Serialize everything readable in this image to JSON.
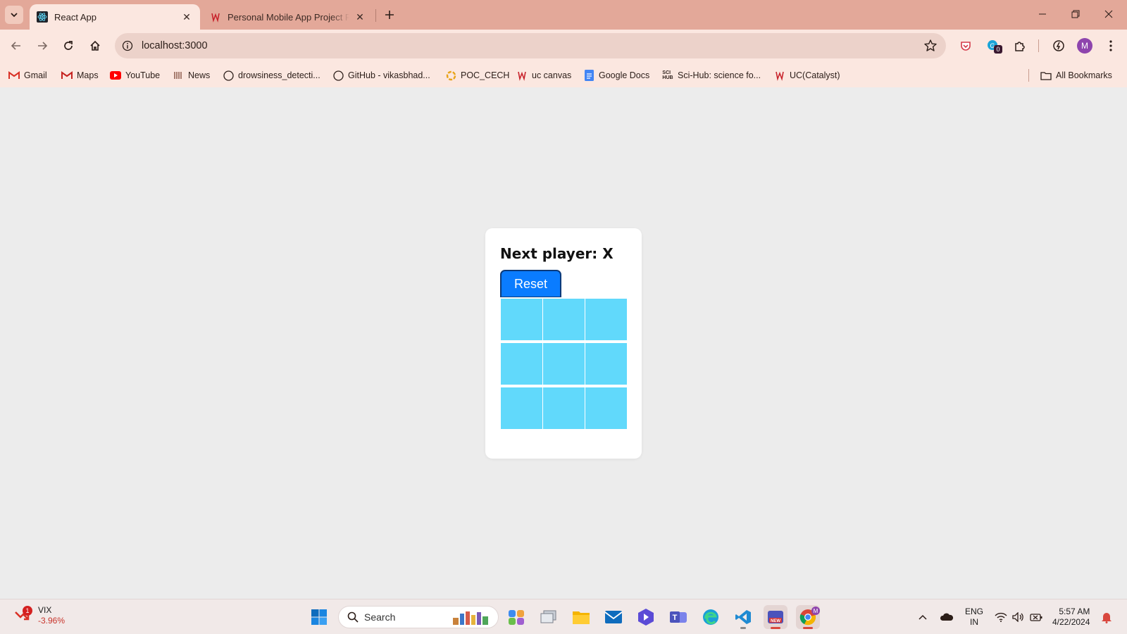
{
  "browser": {
    "tabs": [
      {
        "title": "React App",
        "active": true,
        "icon": "react-icon"
      },
      {
        "title": "Personal Mobile App Project Fi",
        "active": false,
        "icon": "uc-icon"
      }
    ],
    "address": "localhost:3000",
    "bookmarks": [
      {
        "label": "Gmail",
        "icon": "gmail-icon"
      },
      {
        "label": "Maps",
        "icon": "maps-icon"
      },
      {
        "label": "YouTube",
        "icon": "youtube-icon"
      },
      {
        "label": "News",
        "icon": "news-icon"
      },
      {
        "label": "drowsiness_detecti...",
        "icon": "github-icon"
      },
      {
        "label": "GitHub - vikasbhad...",
        "icon": "github-icon"
      },
      {
        "label": "POC_CECH",
        "icon": "poc-icon"
      },
      {
        "label": "uc canvas",
        "icon": "uc-icon"
      },
      {
        "label": "Google Docs",
        "icon": "docs-icon"
      },
      {
        "label": "Sci-Hub: science fo...",
        "icon": "scihub-icon"
      },
      {
        "label": "UC(Catalyst)",
        "icon": "uc-icon"
      }
    ],
    "all_bookmarks": "All Bookmarks",
    "extension_badge": "0",
    "profile_initial": "M"
  },
  "game": {
    "status": "Next player: X",
    "reset_label": "Reset",
    "squares": [
      "",
      "",
      "",
      "",
      "",
      "",
      "",
      "",
      ""
    ],
    "square_color": "#61d9fb",
    "button_color": "#0a7cff"
  },
  "taskbar": {
    "widget": {
      "name": "VIX",
      "change": "-3.96%",
      "badge": "1"
    },
    "search_label": "Search",
    "language": [
      "ENG",
      "IN"
    ],
    "time": "5:57 AM",
    "date": "4/22/2024",
    "teams_badge": "NEW",
    "chrome_badge": "M"
  }
}
